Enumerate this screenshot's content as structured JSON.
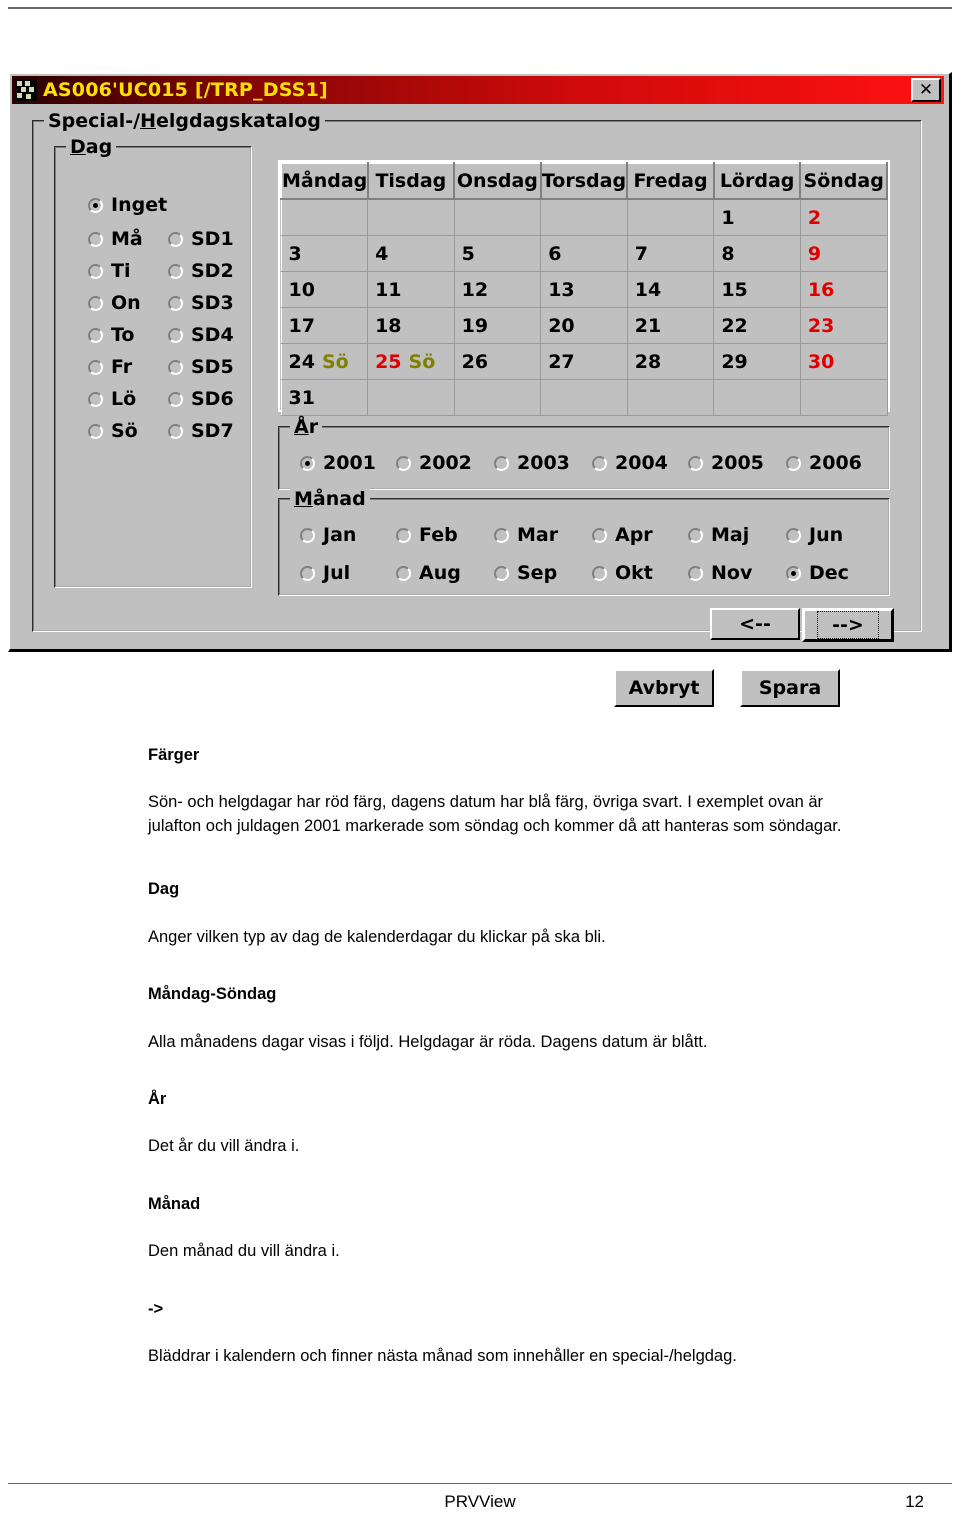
{
  "window": {
    "title": "AS006'UC015 [/TRP_DSS1]",
    "close_label": "✕",
    "icon_name": "app-icon"
  },
  "groups": {
    "katalog": {
      "legend_pre": "Special-/",
      "legend_accel": "H",
      "legend_post": "elgdagskatalog"
    },
    "dag": {
      "legend_accel": "D",
      "legend_post": "ag"
    },
    "ar": {
      "legend_accel": "Å",
      "legend_post": "r"
    },
    "manad": {
      "legend_accel": "M",
      "legend_post": "ånad"
    }
  },
  "dag": {
    "inget": "Inget",
    "weekdays": [
      "Må",
      "Ti",
      "On",
      "To",
      "Fr",
      "Lö",
      "Sö"
    ],
    "special": [
      "SD1",
      "SD2",
      "SD3",
      "SD4",
      "SD5",
      "SD6",
      "SD7"
    ],
    "selected": "Inget"
  },
  "calendar": {
    "headers": [
      "Måndag",
      "Tisdag",
      "Onsdag",
      "Torsdag",
      "Fredag",
      "Lördag",
      "Söndag"
    ],
    "rows": [
      [
        {
          "num": ""
        },
        {
          "num": ""
        },
        {
          "num": ""
        },
        {
          "num": ""
        },
        {
          "num": ""
        },
        {
          "num": "1"
        },
        {
          "num": "2",
          "red": true
        }
      ],
      [
        {
          "num": "3"
        },
        {
          "num": "4"
        },
        {
          "num": "5"
        },
        {
          "num": "6"
        },
        {
          "num": "7"
        },
        {
          "num": "8"
        },
        {
          "num": "9",
          "red": true
        }
      ],
      [
        {
          "num": "10"
        },
        {
          "num": "11"
        },
        {
          "num": "12"
        },
        {
          "num": "13"
        },
        {
          "num": "14"
        },
        {
          "num": "15"
        },
        {
          "num": "16",
          "red": true
        }
      ],
      [
        {
          "num": "17"
        },
        {
          "num": "18"
        },
        {
          "num": "19"
        },
        {
          "num": "20"
        },
        {
          "num": "21"
        },
        {
          "num": "22"
        },
        {
          "num": "23",
          "red": true
        }
      ],
      [
        {
          "num": "24",
          "tag": "Sö"
        },
        {
          "num": "25",
          "red": true,
          "tag": "Sö"
        },
        {
          "num": "26"
        },
        {
          "num": "27"
        },
        {
          "num": "28"
        },
        {
          "num": "29"
        },
        {
          "num": "30",
          "red": true
        }
      ],
      [
        {
          "num": "31"
        },
        {
          "num": ""
        },
        {
          "num": ""
        },
        {
          "num": ""
        },
        {
          "num": ""
        },
        {
          "num": ""
        },
        {
          "num": ""
        }
      ]
    ],
    "colors": {
      "holiday": "#e00000",
      "normal": "#000000",
      "tag": "#808000"
    }
  },
  "year": {
    "options": [
      "2001",
      "2002",
      "2003",
      "2004",
      "2005",
      "2006"
    ],
    "selected": "2001"
  },
  "month": {
    "options": [
      "Jan",
      "Feb",
      "Mar",
      "Apr",
      "Maj",
      "Jun",
      "Jul",
      "Aug",
      "Sep",
      "Okt",
      "Nov",
      "Dec"
    ],
    "selected": "Dec"
  },
  "buttons": {
    "prev": "<--",
    "next": "-->",
    "cancel": "Avbryt",
    "save": "Spara"
  },
  "doc": {
    "h_farger": "Färger",
    "p_farger": "Sön- och helgdagar har röd färg, dagens datum har blå färg, övriga svart. I exemplet ovan är julafton och juldagen 2001 markerade som söndag och kommer då att hanteras som söndagar.",
    "h_dag": "Dag",
    "p_dag": "Anger vilken typ av dag de kalenderdagar du klickar på ska bli.",
    "h_mansondag": "Måndag-Söndag",
    "p_mansondag": "Alla månadens dagar visas i följd. Helgdagar är röda. Dagens datum är blått.",
    "h_ar": "År",
    "p_ar": "Det år du vill ändra i.",
    "h_manad": "Månad",
    "p_manad": "Den månad du vill ändra i.",
    "h_arrow": "->",
    "p_arrow": "Bläddrar i kalendern och finner nästa månad som innehåller en special-/helgdag."
  },
  "footer": {
    "name": "PRVView",
    "page": "12"
  }
}
